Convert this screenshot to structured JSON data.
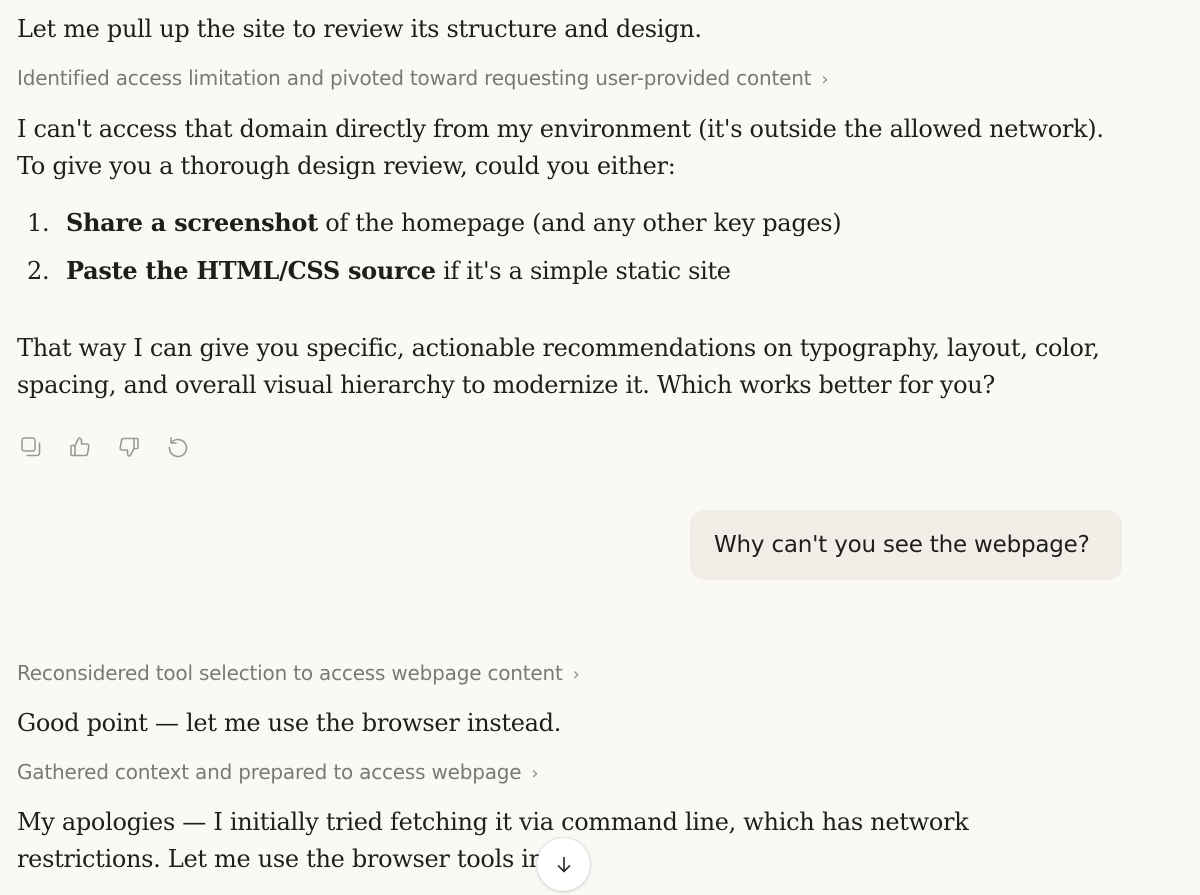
{
  "messages": {
    "intro": "Let me pull up the site to review its structure and design.",
    "thinking1": "Identified access limitation and pivoted toward requesting user-provided content",
    "access_line1": "I can't access that domain directly from my environment (it's outside the allowed network).",
    "access_line2": "To give you a thorough design review, could you either:",
    "list": [
      {
        "num": "1.",
        "bold": "Share a screenshot",
        "rest": " of the homepage (and any other key pages)"
      },
      {
        "num": "2.",
        "bold": "Paste the HTML/CSS source",
        "rest": " if it's a simple static site"
      }
    ],
    "closing_line1": "That way I can give you specific, actionable recommendations on typography, layout, color,",
    "closing_line2": "spacing, and overall visual hierarchy to modernize it. Which works better for you?",
    "user_message": "Why can't you see the webpage?",
    "thinking2": "Reconsidered tool selection to access webpage content",
    "reply1": "Good point — let me use the browser instead.",
    "thinking3": "Gathered context and prepared to access webpage",
    "reply2_line1": "My apologies — I initially tried fetching it via command line, which has network",
    "reply2_line2": "restrictions. Let me use the browser tools inst"
  },
  "thinking_chevron": "›",
  "actions": [
    {
      "icon": "copy-icon"
    },
    {
      "icon": "thumbs-up-icon"
    },
    {
      "icon": "thumbs-down-icon"
    },
    {
      "icon": "retry-icon"
    }
  ],
  "scroll_button": {
    "icon": "arrow-down-icon"
  },
  "colors": {
    "background": "#faf9f5",
    "text": "#1f1e1d",
    "muted": "#7a7974",
    "user_bubble": "#f0eee6"
  }
}
